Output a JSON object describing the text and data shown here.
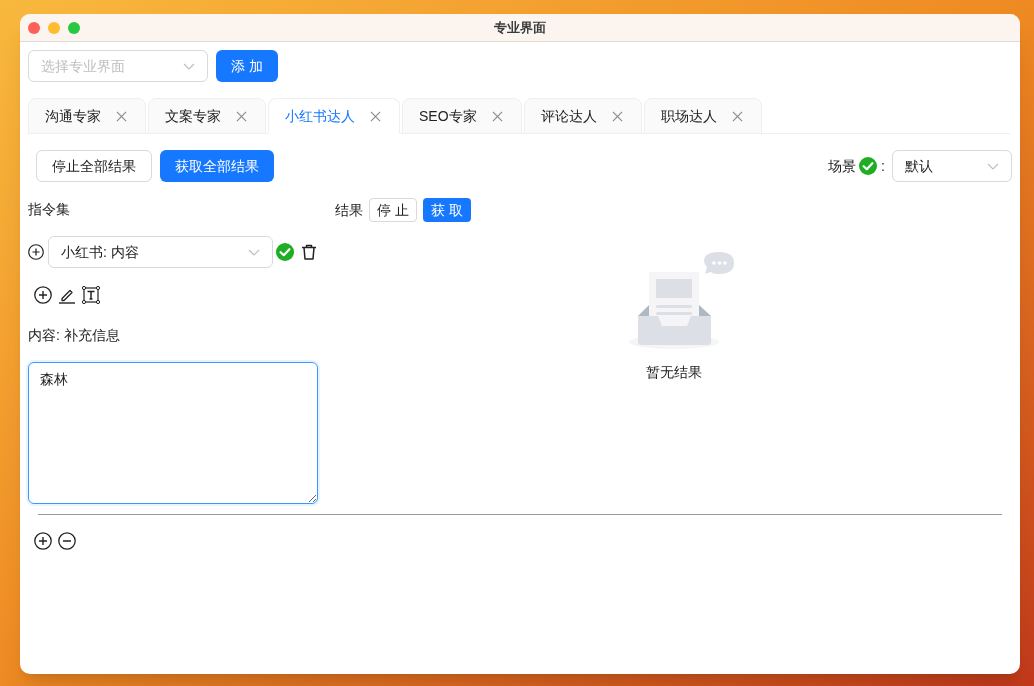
{
  "window": {
    "title": "专业界面"
  },
  "toolbar": {
    "profession_select": {
      "placeholder": "选择专业界面"
    },
    "add_button": "添 加"
  },
  "tabs": [
    {
      "label": "沟通专家",
      "selected": false
    },
    {
      "label": "文案专家",
      "selected": false
    },
    {
      "label": "小红书达人",
      "selected": true
    },
    {
      "label": "SEO专家",
      "selected": false
    },
    {
      "label": "评论达人",
      "selected": false
    },
    {
      "label": "职场达人",
      "selected": false
    }
  ],
  "actions": {
    "stop_all_button": "停止全部结果",
    "fetch_all_button": "获取全部结果",
    "scene": {
      "label": "场景",
      "valid": true,
      "separator": ":",
      "value": "默认"
    }
  },
  "instructions": {
    "title": "指令集",
    "items": [
      {
        "value": "小红书: 内容",
        "valid": true
      }
    ],
    "content": {
      "label": "内容: 补充信息",
      "value": "森林",
      "focused": true
    }
  },
  "results": {
    "title": "结果",
    "stop_button": "停 止",
    "fetch_button": "获 取",
    "empty_text": "暂无结果"
  }
}
